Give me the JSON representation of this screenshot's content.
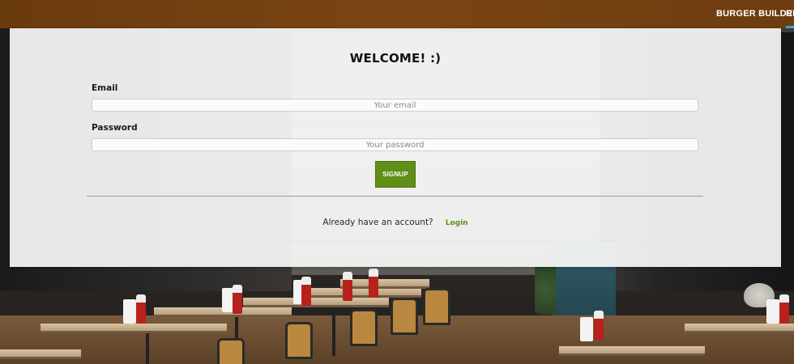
{
  "nav": {
    "burger_builder_label": "BURGER BUILDER",
    "next_label": "R"
  },
  "login_panel": {
    "title": "WELCOME! :)",
    "email": {
      "label": "Email",
      "placeholder": "Your email",
      "value": ""
    },
    "password": {
      "label": "Password",
      "placeholder": "Your password",
      "value": ""
    },
    "signup_label": "SIGNUP",
    "account_prompt": "Already have an account?",
    "login_link_label": "Login"
  },
  "colors": {
    "nav_background": "#7a4513",
    "accent_green": "#5e8f17",
    "panel_background": "#f8f8f8"
  }
}
